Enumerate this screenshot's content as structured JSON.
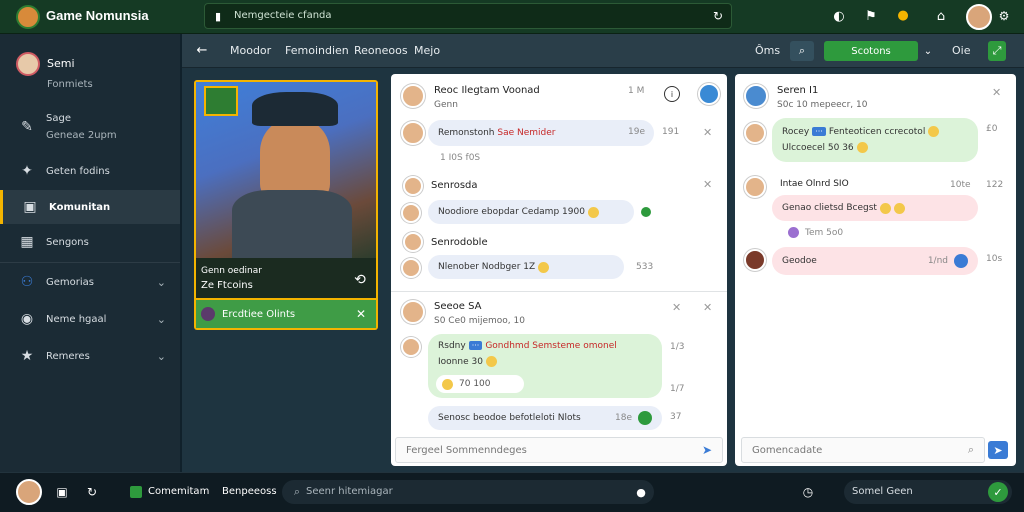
{
  "app": {
    "title": "Game Nomunsia"
  },
  "top": {
    "search_placeholder": "Nemgecteie cfanda"
  },
  "sidebar": {
    "user": {
      "name": "Semi",
      "sub": "Fonmiets"
    },
    "items": [
      {
        "label": "Sage",
        "sub": "Geneae 2upm",
        "icon": "pen-icon"
      },
      {
        "label": "Geten fodins",
        "icon": "star-icon"
      },
      {
        "label": "Komunitan",
        "icon": "flag-icon",
        "active": true
      },
      {
        "label": "Sengons",
        "icon": "grid-icon"
      },
      {
        "label": "Gemorias",
        "icon": "users-icon"
      },
      {
        "label": "Neme hgaal",
        "icon": "circle-icon"
      },
      {
        "label": "Remeres",
        "icon": "star-icon"
      }
    ]
  },
  "tabs": [
    "Moodor",
    "Femoindien",
    "Reoneoos",
    "Mejo"
  ],
  "toolbar": {
    "left_label": "Ôms",
    "btn": "Scotons",
    "right_label": "Oie"
  },
  "card": {
    "title": "Genn oedinar",
    "sub": "Ze Ftcoins",
    "footer": "Ercdtiee Olints"
  },
  "threads": [
    {
      "name": "Reoc Ilegtam Voonad",
      "badge": "Genn",
      "time": "1 M"
    },
    {
      "name": "Remonstonh",
      "accent": "Sae Nemider",
      "time": "19e",
      "count": "191"
    },
    {
      "meta": "1  I0S f0S"
    },
    {
      "name": "Senrosda"
    },
    {
      "text": "Noodiore ebopdar Cedamp 1900",
      "time": ""
    },
    {
      "name": "Senrodoble"
    },
    {
      "text": "Nlenober Nodbger 1Z",
      "time": "533"
    }
  ],
  "thread2": {
    "name": "Seeoe SA",
    "sub": "S0 Ce0 mijemoo, 10",
    "lines": [
      {
        "label": "Rsdny",
        "text": "Gondhmd Semsteme omonel",
        "sub": "Ioonne 30",
        "time": "1/3"
      },
      {
        "text": "70 100",
        "time": "1/7"
      },
      {
        "text": "Senosc beodoe befotleloti Nlots",
        "time": "18e",
        "count": "37"
      }
    ],
    "compose": "Fergeel Sommenndeges"
  },
  "chat": {
    "name": "Seren I1",
    "sub": "S0c 10 mepeecr, 10",
    "messages": [
      {
        "label": "Rocey",
        "text": "Fenteoticen ccrecotol",
        "sub": "Ulccoecel 50 36",
        "time": "£0"
      },
      {
        "name": "Intae Olnrd",
        "num": "SIO",
        "time": "10te",
        "count": "122",
        "text": "Genao clietsd Bcegst"
      },
      {
        "meta": "Tem 5o0"
      },
      {
        "text": "Geodoe",
        "time": "1/nd",
        "count": "10s"
      }
    ],
    "compose": "Gomencadate"
  },
  "bottom": {
    "btn": "Comemitam",
    "label": "Benpeeoss",
    "search_placeholder": "Seenr hitemiagar",
    "right_search": "Somel Geen"
  }
}
